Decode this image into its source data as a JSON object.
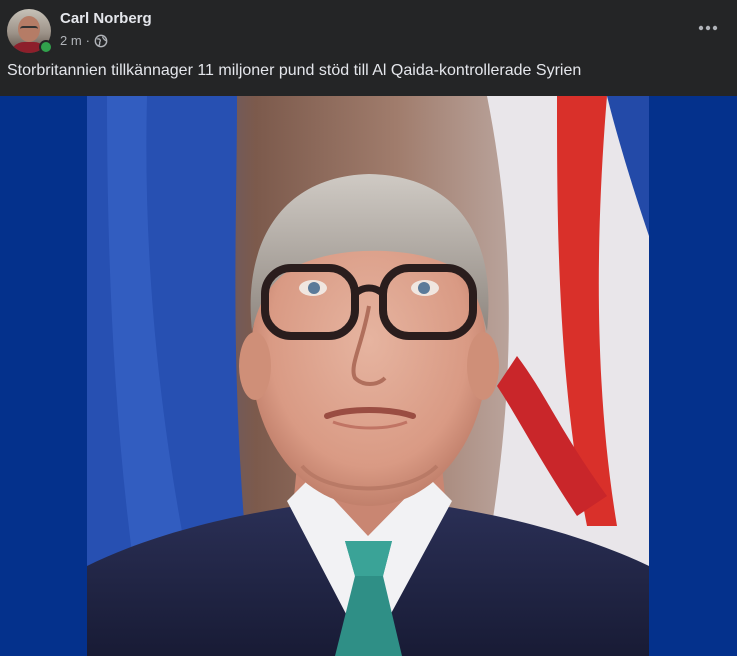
{
  "post": {
    "author_name": "Carl Norberg",
    "time": "2 m",
    "separator": "·",
    "privacy_icon": "globe-icon",
    "more_icon": "more-options-icon",
    "caption": "Storbritannien tillkännager 11 miljoner pund stöd till Al Qaida-kontrollerade Syrien",
    "online": true
  },
  "colors": {
    "background": "#242526",
    "media_background": "#04318c",
    "online_dot": "#31a24c",
    "text_primary": "#e4e6eb",
    "text_secondary": "#b0b3b8"
  }
}
